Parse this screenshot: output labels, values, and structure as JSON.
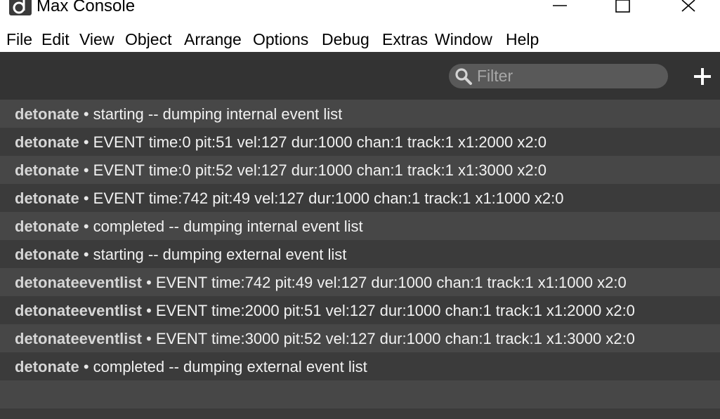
{
  "window": {
    "title": "Max Console",
    "icon": "max-logo-icon",
    "controls": [
      "minimize-icon",
      "maximize-icon",
      "close-icon"
    ]
  },
  "menu": [
    {
      "label": "File"
    },
    {
      "label": "Edit"
    },
    {
      "label": "View"
    },
    {
      "label": "Object"
    },
    {
      "label": "Arrange"
    },
    {
      "label": "Options"
    },
    {
      "label": "Debug"
    },
    {
      "label": "Extras"
    },
    {
      "label": "Window"
    },
    {
      "label": "Help"
    }
  ],
  "toolbar": {
    "filter": {
      "value": "",
      "placeholder": "Filter",
      "icon": "search-icon"
    },
    "add_icon": "plus-icon"
  },
  "log": [
    {
      "source": "detonate",
      "sep": "•",
      "message": "starting -- dumping internal event list"
    },
    {
      "source": "detonate",
      "sep": "•",
      "message": "EVENT time:0 pit:51 vel:127 dur:1000 chan:1 track:1 x1:2000 x2:0"
    },
    {
      "source": "detonate",
      "sep": "•",
      "message": "EVENT time:0 pit:52 vel:127 dur:1000 chan:1 track:1 x1:3000 x2:0"
    },
    {
      "source": "detonate",
      "sep": "•",
      "message": "EVENT time:742 pit:49 vel:127 dur:1000 chan:1 track:1 x1:1000 x2:0"
    },
    {
      "source": "detonate",
      "sep": "•",
      "message": "completed -- dumping internal event list"
    },
    {
      "source": "detonate",
      "sep": "•",
      "message": "starting -- dumping external event list"
    },
    {
      "source": "detonateeventlist",
      "sep": "•",
      "message": "EVENT time:742 pit:49 vel:127 dur:1000 chan:1 track:1 x1:1000 x2:0"
    },
    {
      "source": "detonateeventlist",
      "sep": "•",
      "message": "EVENT time:2000 pit:51 vel:127 dur:1000 chan:1 track:1 x1:2000 x2:0"
    },
    {
      "source": "detonateeventlist",
      "sep": "•",
      "message": "EVENT time:3000 pit:52 vel:127 dur:1000 chan:1 track:1 x1:3000 x2:0"
    },
    {
      "source": "detonate",
      "sep": "•",
      "message": "completed -- dumping external event list"
    }
  ],
  "colors": {
    "toolbar_bg": "#333333",
    "row_light": "#474747",
    "row_dark": "#3b3b3b",
    "filter_bg": "#595959",
    "text": "#ffffff"
  }
}
